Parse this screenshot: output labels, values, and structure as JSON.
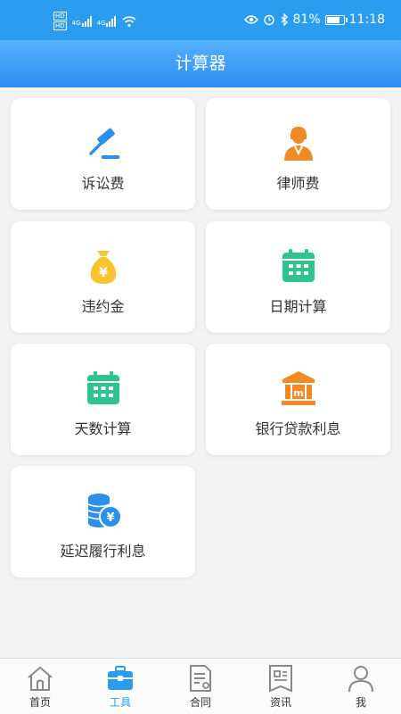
{
  "status_bar": {
    "hd_labels": [
      "HD",
      "HD"
    ],
    "network_labels": [
      "4G",
      "4G"
    ],
    "battery": "81%",
    "battery_level": 0.81,
    "time": "11:18",
    "icons": [
      "eye-icon",
      "alarm-icon",
      "bluetooth-icon",
      "wifi-icon",
      "battery-icon"
    ]
  },
  "header": {
    "title": "计算器"
  },
  "tools": [
    {
      "label": "诉讼费",
      "icon": "gavel-icon"
    },
    {
      "label": "律师费",
      "icon": "lawyer-icon"
    },
    {
      "label": "违约金",
      "icon": "money-bag-icon"
    },
    {
      "label": "日期计算",
      "icon": "calendar-icon"
    },
    {
      "label": "天数计算",
      "icon": "calendar-icon"
    },
    {
      "label": "银行贷款利息",
      "icon": "bank-icon"
    },
    {
      "label": "延迟履行利息",
      "icon": "coins-icon"
    }
  ],
  "tabbar": {
    "items": [
      {
        "label": "首页",
        "icon": "home-icon"
      },
      {
        "label": "工具",
        "icon": "toolbox-icon",
        "active": true
      },
      {
        "label": "合同",
        "icon": "contract-icon"
      },
      {
        "label": "资讯",
        "icon": "news-icon"
      },
      {
        "label": "我",
        "icon": "user-icon"
      }
    ]
  },
  "colors": {
    "primary": "#2b9df0",
    "orange": "#f08a24",
    "yellow": "#f7c532",
    "green": "#2fc48d",
    "blue_icon": "#2d8fea"
  }
}
